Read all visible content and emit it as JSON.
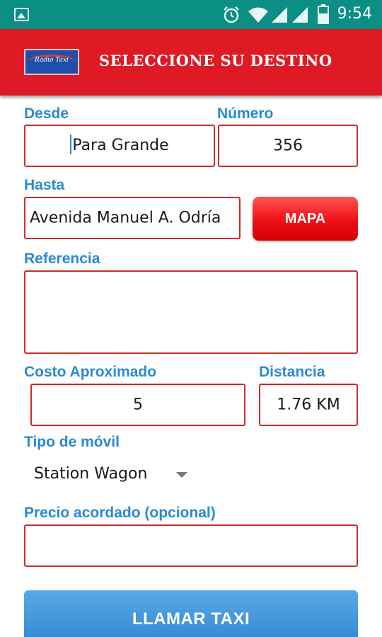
{
  "status_bar": {
    "time": "9:54",
    "icons": [
      "image-icon",
      "alarm-icon",
      "wifi-icon",
      "signal-icon",
      "signal-icon",
      "battery-icon"
    ]
  },
  "header": {
    "logo_text": "Radio Taxi",
    "title": "SELECCIONE SU DESTINO"
  },
  "form": {
    "desde": {
      "label": "Desde",
      "value": "Para Grande"
    },
    "numero": {
      "label": "Número",
      "value": "356"
    },
    "hasta": {
      "label": "Hasta",
      "value": "Avenida Manuel A. Odría"
    },
    "mapa_button": "MAPA",
    "referencia": {
      "label": "Referencia",
      "value": ""
    },
    "costo": {
      "label": "Costo Aproximado",
      "value": "5"
    },
    "distancia": {
      "label": "Distancia",
      "value": "1.76 KM"
    },
    "tipo_movil": {
      "label": "Tipo de móvil",
      "selected": "Station Wagon"
    },
    "precio": {
      "label": "Precio acordado (opcional)",
      "value": ""
    },
    "call_button": "LLAMAR TAXI"
  },
  "colors": {
    "status_bar": "#0b8f84",
    "header": "#e01a24",
    "label": "#2a8ad2",
    "field_border": "#cf2a2a",
    "call_button": "#3a8fd6"
  }
}
